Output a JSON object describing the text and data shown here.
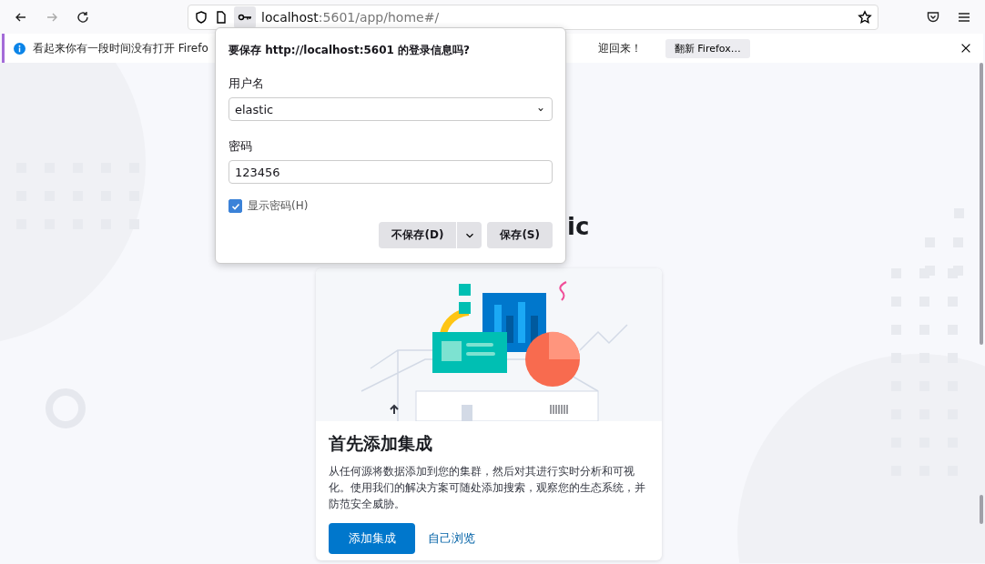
{
  "toolbar": {
    "url_host": "localhost",
    "url_rest": ":5601/app/home#/"
  },
  "notification": {
    "message": "看起来你有一段时间没有打开 Firefo",
    "message_tail": "迎回来！",
    "button": "翻新 Firefox…"
  },
  "page": {
    "heading": "ic",
    "card": {
      "title": "首先添加集成",
      "description": "从任何源将数据添加到您的集群，然后对其进行实时分析和可视化。使用我们的解决方案可随处添加搜索，观察您的生态系统，并防范安全威胁。",
      "primary_button": "添加集成",
      "link": "自己浏览"
    }
  },
  "popup": {
    "title": "要保存 http://localhost:5601 的登录信息吗?",
    "username_label": "用户名",
    "username": "elastic",
    "password_label": "密码",
    "password": "123456",
    "show_password": {
      "label": "显示密码(H)",
      "checked": true
    },
    "dont_save": "不保存(D)",
    "save": "保存(S)"
  }
}
